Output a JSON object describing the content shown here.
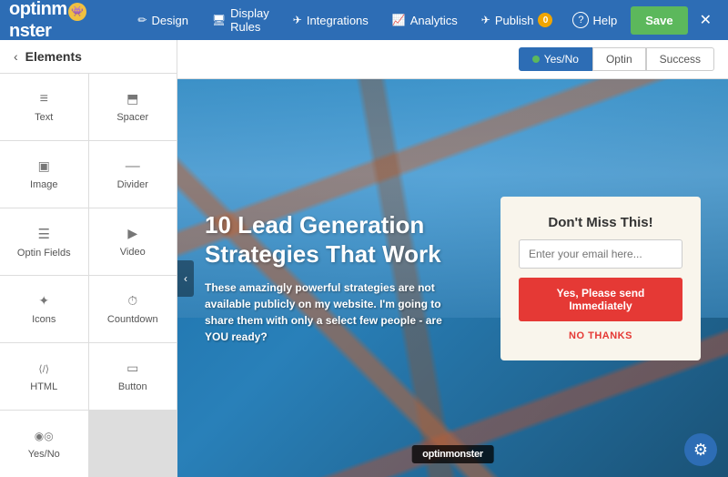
{
  "logo": {
    "text_before": "optinm",
    "text_after": "nster"
  },
  "nav": {
    "items": [
      {
        "id": "design",
        "label": "Design",
        "icon": "✏"
      },
      {
        "id": "display-rules",
        "label": "Display Rules",
        "icon": "🖥"
      },
      {
        "id": "integrations",
        "label": "Integrations",
        "icon": "✈"
      },
      {
        "id": "analytics",
        "label": "Analytics",
        "icon": "📈"
      }
    ],
    "publish_label": "Publish",
    "publish_badge": "0",
    "help_label": "Help",
    "save_label": "Save",
    "close_label": "✕"
  },
  "sidebar": {
    "back_label": "‹",
    "title": "Elements",
    "elements": [
      {
        "id": "text",
        "label": "Text",
        "icon": "lines"
      },
      {
        "id": "spacer",
        "label": "Spacer",
        "icon": "spacer"
      },
      {
        "id": "image",
        "label": "Image",
        "icon": "image"
      },
      {
        "id": "divider",
        "label": "Divider",
        "icon": "divider"
      },
      {
        "id": "optin-fields",
        "label": "Optin Fields",
        "icon": "fields"
      },
      {
        "id": "video",
        "label": "Video",
        "icon": "video"
      },
      {
        "id": "icons",
        "label": "Icons",
        "icon": "icons"
      },
      {
        "id": "countdown",
        "label": "Countdown",
        "icon": "countdown"
      },
      {
        "id": "html",
        "label": "HTML",
        "icon": "html"
      },
      {
        "id": "button",
        "label": "Button",
        "icon": "button"
      },
      {
        "id": "yes-no",
        "label": "Yes/No",
        "icon": "yesno"
      }
    ]
  },
  "canvas_tabs": [
    {
      "id": "yesno",
      "label": "Yes/No",
      "active": true
    },
    {
      "id": "optin",
      "label": "Optin",
      "active": false
    },
    {
      "id": "success",
      "label": "Success",
      "active": false
    }
  ],
  "canvas": {
    "headline": "10 Lead Generation Strategies That Work",
    "subtext": "These amazingly powerful strategies are not available publicly on my website. I'm going to share them with only a select few people - are YOU ready?",
    "optin_box": {
      "title": "Don't Miss This!",
      "input_placeholder": "Enter your email here...",
      "submit_label": "Yes, Please send Immediately",
      "no_label": "NO THANKS"
    },
    "bottom_logo": "optinmonster"
  }
}
